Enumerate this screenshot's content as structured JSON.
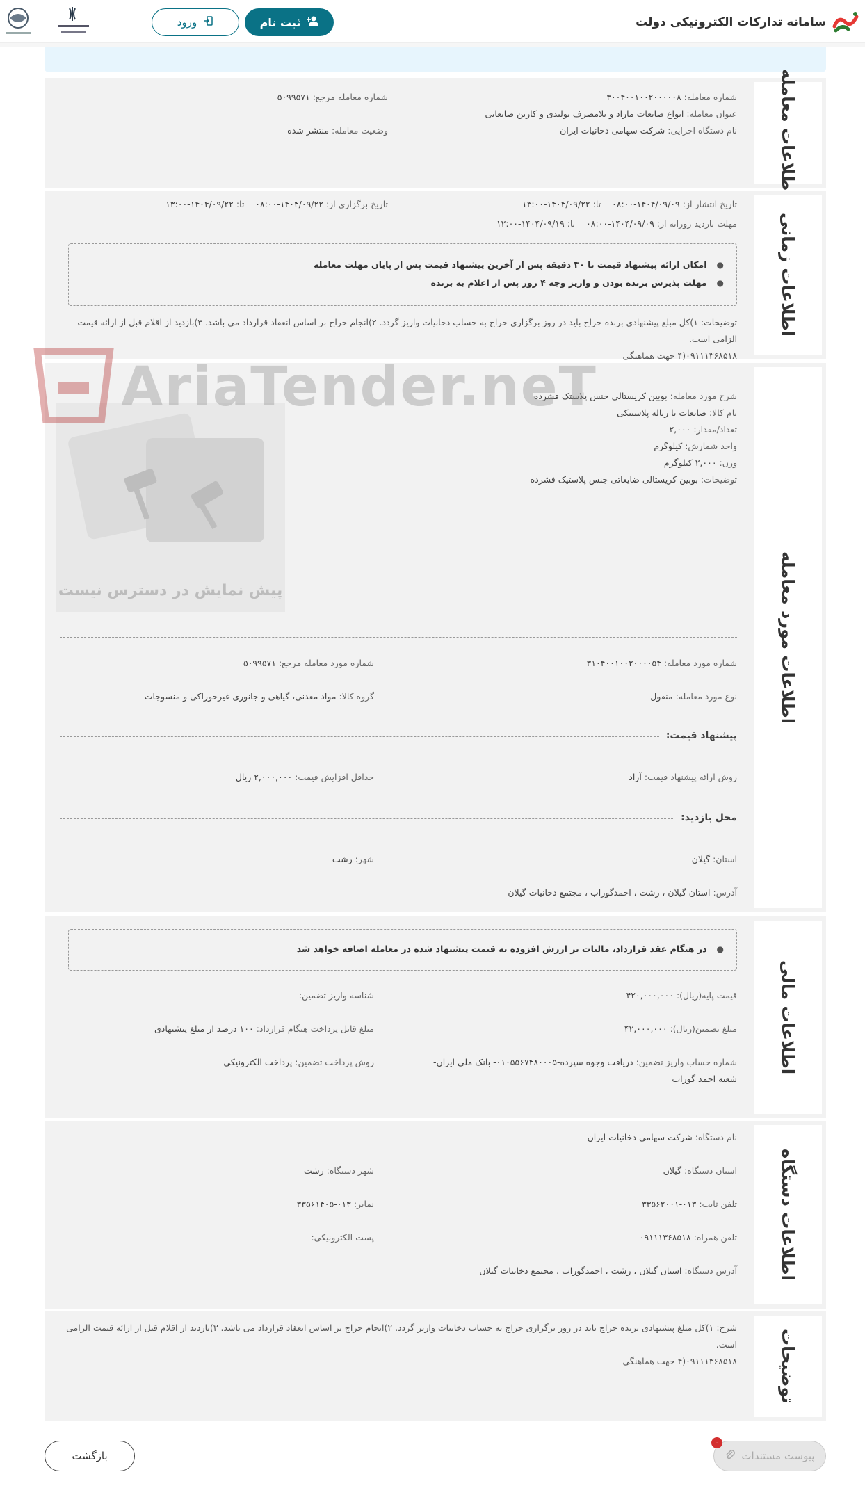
{
  "header": {
    "brand_title": "سامانه تدارکات الکترونیکی دولت",
    "login_label": "ورود",
    "register_label": "ثبت نام"
  },
  "deal_info": {
    "tab": "اطلاعات معامله",
    "deal_number_label": "شماره معامله:",
    "deal_number": "۳۰۰۴۰۰۱۰۰۲۰۰۰۰۰۸",
    "ref_number_label": "شماره معامله مرجع:",
    "ref_number": "۵۰۹۹۵۷۱",
    "title_label": "عنوان معامله:",
    "title": "انواع ضایعات مازاد و بلامصرف تولیدی و کارتن ضایعاتی",
    "executor_label": "نام دستگاه اجرایی:",
    "executor": "شرکت سهامی دخانیات ایران",
    "status_label": "وضعیت معامله:",
    "status": "منتشر شده"
  },
  "time_info": {
    "tab": "اطلاعات زمانی",
    "publish_from_label": "تاریخ انتشار از:",
    "publish_from": "۱۴۰۴/۰۹/۰۹-۰۸:۰۰",
    "publish_to_label": "تا:",
    "publish_to": "۱۴۰۴/۰۹/۲۲-۱۳:۰۰",
    "hold_from_label": "تاریخ برگزاری از:",
    "hold_from": "۱۴۰۴/۰۹/۲۲-۰۸:۰۰",
    "hold_to_label": "تا:",
    "hold_to": "۱۴۰۴/۰۹/۲۲-۱۳:۰۰",
    "visit_from_label": "مهلت بازدید روزانه از:",
    "visit_from": "۱۴۰۴/۰۹/۰۹-۰۸:۰۰",
    "visit_to_label": "تا:",
    "visit_to": "۱۴۰۴/۰۹/۱۹-۱۲:۰۰",
    "bullet_1": "امکان ارائه پیشنهاد قیمت تا ۳۰ دقیقه پس از آخرین پیشنهاد قیمت پس از پایان مهلت معامله",
    "bullet_2": "مهلت پذیرش برنده بودن و واریز وجه ۴ روز پس از اعلام به برنده",
    "desc_label": "توضیحات:",
    "desc_1": "۱)کل مبلغ پیشنهادی برنده حراج باید در روز برگزاری حراج به حساب دخانیات واریز گردد. ۲)انجام حراج بر اساس انعقاد قرارداد می باشد. ۳)بازدید از اقلام قبل از ارائه قیمت الزامی است.",
    "desc_2": "۰۹۱۱۱۳۶۸۵۱۸(۴ جهت هماهنگی"
  },
  "item_info": {
    "tab": "اطلاعات مورد معامله",
    "watermark": "AriaTender.neT",
    "no_preview": "پیش نمایش در دسترس نیست",
    "desc_label": "شرح مورد معامله:",
    "desc": "بوبین کریستالی جنس پلاستک فشرده",
    "goods_label": "نام کالا:",
    "goods": "ضایعات یا زباله پلاستیکی",
    "qty_label": "تعداد/مقدار:",
    "qty": "۲,۰۰۰",
    "unit_label": "واحد شمارش:",
    "unit": "کیلوگرم",
    "weight_label": "وزن:",
    "weight": "۲,۰۰۰ کیلوگرم",
    "notes_label": "توضیحات:",
    "notes": "بوبین کریستالی ضایعاتی جنس پلاستیک فشرده",
    "item_number_label": "شماره مورد معامله:",
    "item_number": "۳۱۰۴۰۰۱۰۰۲۰۰۰۰۵۴",
    "item_ref_label": "شماره مورد معامله مرجع:",
    "item_ref": "۵۰۹۹۵۷۱",
    "item_type_label": "نوع مورد معامله:",
    "item_type": "منقول",
    "group_label": "گروه کالا:",
    "group": "مواد معدنی، گیاهی و جانوری غیرخوراکی و منسوجات",
    "price_head": "پیشنهاد قیمت:",
    "method_label": "روش ارائه پیشنهاد قیمت:",
    "method": "آزاد",
    "min_inc_label": "حداقل افزایش قیمت:",
    "min_inc": "۲,۰۰۰,۰۰۰ ریال",
    "visit_head": "محل بازدید:",
    "province_label": "استان:",
    "province": "گیلان",
    "city_label": "شهر:",
    "city": "رشت",
    "address_label": "آدرس:",
    "address": "استان گیلان ، رشت ، احمدگوراب ، مجتمع دخانیات گیلان"
  },
  "financial": {
    "tab": "اطلاعات مالی",
    "bullet": "در هنگام عقد قرارداد، مالیات بر ارزش افزوده به قیمت پیشنهاد شده در معامله اضافه خواهد شد",
    "base_price_label": "قیمت پایه(ریال):",
    "base_price": "۴۲۰,۰۰۰,۰۰۰",
    "deposit_id_label": "شناسه واریز تضمین:",
    "deposit_id": "-",
    "guarantee_label": "مبلغ تضمین(ریال):",
    "guarantee": "۴۲,۰۰۰,۰۰۰",
    "payable_label": "مبلغ قابل پرداخت هنگام قرارداد:",
    "payable": "۱۰۰ درصد از مبلغ پیشنهادی",
    "account_label": "شماره حساب واریز تضمین:",
    "account": "دریافت وجوه سپرده-۰۱۰۵۵۶۷۴۸۰۰۰۵- بانک ملي ایران-",
    "account_2": "شعبه احمد گوراب",
    "pay_method_label": "روش پرداخت تضمین:",
    "pay_method": "پرداخت الکترونیکی"
  },
  "org_info": {
    "tab": "اطلاعات دستگاه",
    "name_label": "نام دستگاه:",
    "name": "شرکت سهامی دخانیات ایران",
    "province_label": "استان دستگاه:",
    "province": "گیلان",
    "city_label": "شهر دستگاه:",
    "city": "رشت",
    "phone_label": "تلفن ثابت:",
    "phone": "۰۱۳-۳۳۵۶۲۰۰۱",
    "fax_label": "نمابر:",
    "fax": "۰۱۳-۳۳۵۶۱۴۰۵",
    "mobile_label": "تلفن همراه:",
    "mobile": "۰۹۱۱۱۳۶۸۵۱۸",
    "email_label": "پست الکترونیکی:",
    "email": "-",
    "address_label": "آدرس دستگاه:",
    "address": "استان گیلان ، رشت ، احمدگوراب ، مجتمع دخانیات گیلان"
  },
  "explanations": {
    "tab": "توضیحات",
    "label": "شرح:",
    "line_1": "۱)کل مبلغ پیشنهادی برنده حراج باید در روز برگزاری حراج به حساب دخانیات واریز گردد. ۲)انجام حراج بر اساس انعقاد قرارداد می باشد. ۳)بازدید از اقلام قبل از ارائه قیمت الزامی است.",
    "line_2": "۰۹۱۱۱۳۶۸۵۱۸(۴ جهت هماهنگی"
  },
  "footer": {
    "back_label": "بازگشت",
    "attach_label": "پیوست مستندات",
    "attach_count": "۰"
  },
  "colors": {
    "primary": "#0a7286",
    "section_bg": "#f2f2f2",
    "notice_bg": "#e7f5fd",
    "badge": "#d32f2f"
  }
}
